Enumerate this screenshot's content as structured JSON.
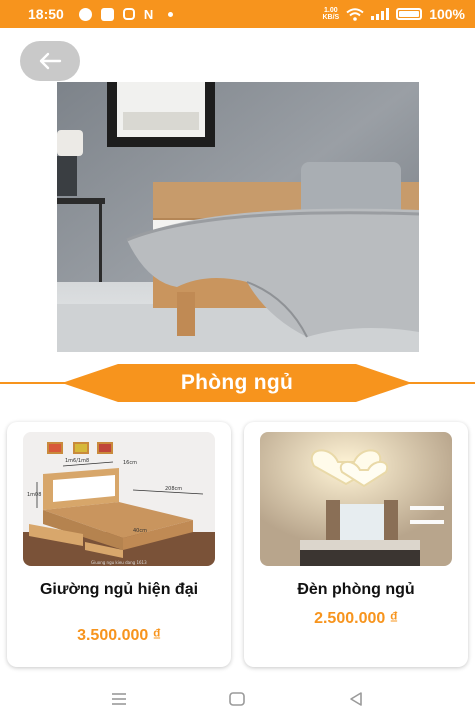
{
  "status_bar": {
    "time": "18:50",
    "network_speed_top": "1.00",
    "network_speed_unit": "KB/S",
    "battery": "100%",
    "app_icons": [
      "messenger-icon",
      "chat-icon",
      "instagram-icon",
      "n-icon"
    ]
  },
  "section": {
    "title": "Phòng ngủ"
  },
  "products": [
    {
      "name": "Giường ngủ hiện đại",
      "price": "3.500.000 ₫",
      "image_caption": "Giuong ngu kieu dang 1613",
      "image_labels": {
        "width": "1m6/1m8",
        "depth": "16cm",
        "height": "1m08",
        "length": "208cm",
        "leg": "40cm"
      }
    },
    {
      "name": "Đèn phòng ngủ",
      "price": "2.500.000 ₫"
    }
  ],
  "colors": {
    "accent": "#f7941d",
    "back_button": "#c9c9c9"
  }
}
